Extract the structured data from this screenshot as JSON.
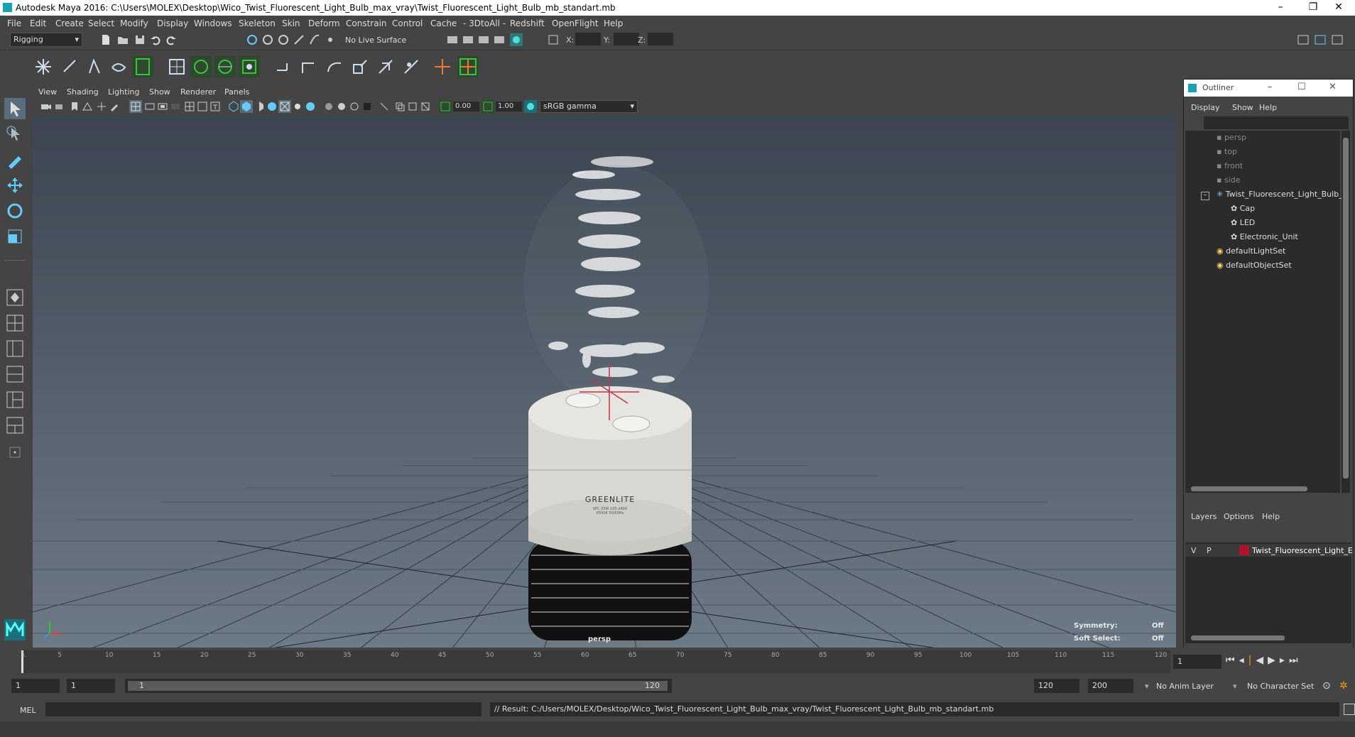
{
  "window": {
    "title": "Autodesk Maya 2016: C:\\Users\\MOLEX\\Desktop\\Wico_Twist_Fluorescent_Light_Bulb_max_vray\\Twist_Fluorescent_Light_Bulb_mb_standart.mb",
    "minimize": "–",
    "restore": "❐",
    "close": "✕"
  },
  "menubar": [
    "File",
    "Edit",
    "Create",
    "Select",
    "Modify",
    "Display",
    "Windows",
    "Skeleton",
    "Skin",
    "Deform",
    "Constrain",
    "Control",
    "Cache",
    "- 3DtoAll -",
    "Redshift",
    "OpenFlight",
    "Help"
  ],
  "statusline": {
    "menuset": "Rigging",
    "live_surface": "No Live Surface",
    "x_label": "X:",
    "y_label": "Y:",
    "z_label": "Z:"
  },
  "viewport": {
    "menu": [
      "View",
      "Shading",
      "Lighting",
      "Show",
      "Renderer",
      "Panels"
    ],
    "near_value": "0.00",
    "far_value": "1.00",
    "color_space": "sRGB gamma",
    "camera_label": "persp",
    "symmetry_label": "Symmetry:",
    "symmetry_value": "Off",
    "soft_select_label": "Soft Select:",
    "soft_select_value": "Off",
    "bulb_brand": "GREENLITE",
    "bulb_spec1": "SPC 25W 220-240V",
    "bulb_spec2": "6500K        50/60Hz"
  },
  "outliner": {
    "title": "Outliner",
    "menu": [
      "Display",
      "Show",
      "Help"
    ],
    "items": [
      {
        "label": "persp",
        "dim": true
      },
      {
        "label": "top",
        "dim": true
      },
      {
        "label": "front",
        "dim": true
      },
      {
        "label": "side",
        "dim": true
      },
      {
        "label": "Twist_Fluorescent_Light_Bulb_",
        "dim": false
      },
      {
        "label": "Cap",
        "dim": false
      },
      {
        "label": "LED",
        "dim": false
      },
      {
        "label": "Electronic_Unit",
        "dim": false
      },
      {
        "label": "defaultLightSet",
        "dim": false
      },
      {
        "label": "defaultObjectSet",
        "dim": false
      }
    ],
    "layers_menu": [
      "Layers",
      "Options",
      "Help"
    ],
    "layer": {
      "v": "V",
      "p": "P",
      "name": "Twist_Fluorescent_Light_E",
      "color": "#b0142a"
    }
  },
  "timeline": {
    "ticks": [
      "1",
      "5",
      "10",
      "15",
      "20",
      "25",
      "30",
      "35",
      "40",
      "45",
      "50",
      "55",
      "60",
      "65",
      "70",
      "75",
      "80",
      "85",
      "90",
      "95",
      "100",
      "105",
      "110",
      "115",
      "120"
    ],
    "current_frame": "1"
  },
  "range": {
    "start": "1",
    "playback_start": "1",
    "slider_start": "1",
    "slider_end": "120",
    "playback_end": "120",
    "end": "200",
    "anim_layer": "No Anim Layer",
    "character_set": "No Character Set"
  },
  "command": {
    "mode": "MEL",
    "result": "// Result: C:/Users/MOLEX/Desktop/Wico_Twist_Fluorescent_Light_Bulb_max_vray/Twist_Fluorescent_Light_Bulb_mb_standart.mb"
  },
  "colors": {
    "accent": "#18a3b5",
    "grid": "#2e3a44",
    "green_highlight": "#3fbf3f"
  }
}
